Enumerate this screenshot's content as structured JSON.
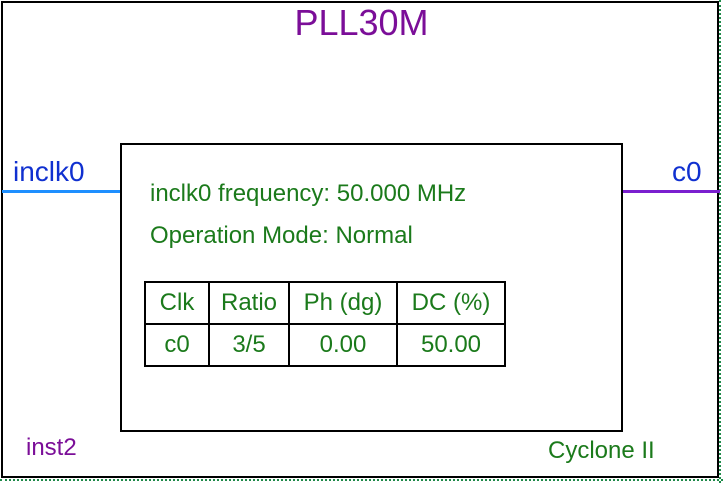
{
  "symbol": {
    "title": "PLL30M",
    "instance": "inst2",
    "device_family": "Cyclone II"
  },
  "ports": {
    "input": "inclk0",
    "output": "c0"
  },
  "info": {
    "frequency": "inclk0 frequency: 50.000 MHz",
    "mode": "Operation Mode: Normal"
  },
  "clock_table": {
    "headers": [
      "Clk",
      "Ratio",
      "Ph (dg)",
      "DC (%)"
    ],
    "rows": [
      [
        "c0",
        "3/5",
        "0.00",
        "50.00"
      ]
    ]
  },
  "colors": {
    "title": "#7b0e98",
    "port_text": "#1030d0",
    "info_text": "#1b7a1b",
    "input_wire": "#1e8fff",
    "output_wire": "#7a1fcf"
  }
}
